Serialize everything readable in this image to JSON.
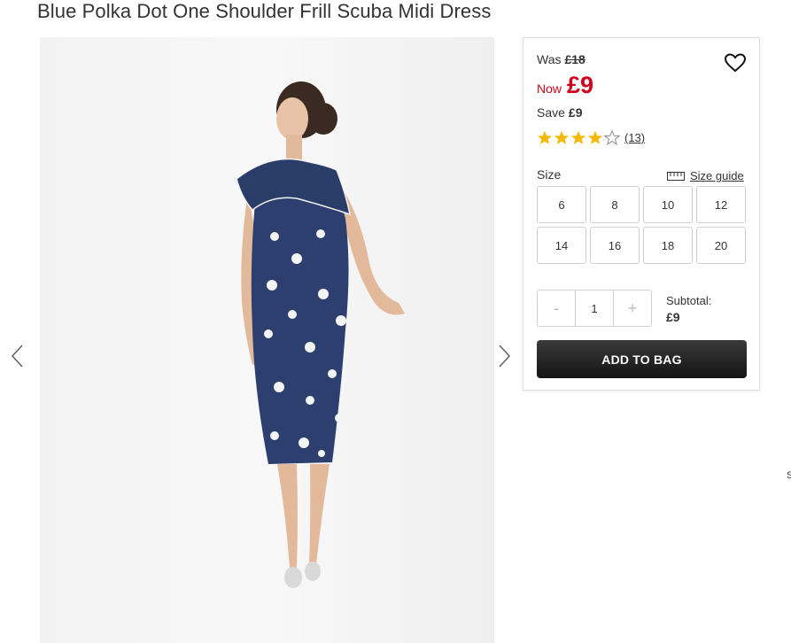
{
  "product": {
    "title": "Blue Polka Dot One Shoulder Frill Scuba Midi Dress"
  },
  "pricing": {
    "was_label": "Was",
    "was_price": "£18",
    "now_label": "Now",
    "now_price": "£9",
    "save_label": "Save",
    "save_amount": "£9"
  },
  "rating": {
    "stars": 4,
    "max_stars": 5,
    "count": "(13)"
  },
  "size": {
    "label": "Size",
    "guide_label": "Size guide",
    "options": [
      "6",
      "8",
      "10",
      "12",
      "14",
      "16",
      "18",
      "20"
    ]
  },
  "quantity": {
    "minus": "-",
    "value": "1",
    "plus": "+"
  },
  "subtotal": {
    "label": "Subtotal:",
    "value": "£9"
  },
  "actions": {
    "add_to_bag": "ADD TO BAG"
  },
  "edge_text": "S",
  "icons": {
    "wishlist": "heart-icon",
    "ruler": "ruler-icon",
    "prev": "chevron-left-icon",
    "next": "chevron-right-icon"
  },
  "colors": {
    "sale_red": "#d0021b",
    "star_gold": "#f5b800",
    "button_dark": "#1f1f1f",
    "dress_navy": "#2c3f6e"
  }
}
